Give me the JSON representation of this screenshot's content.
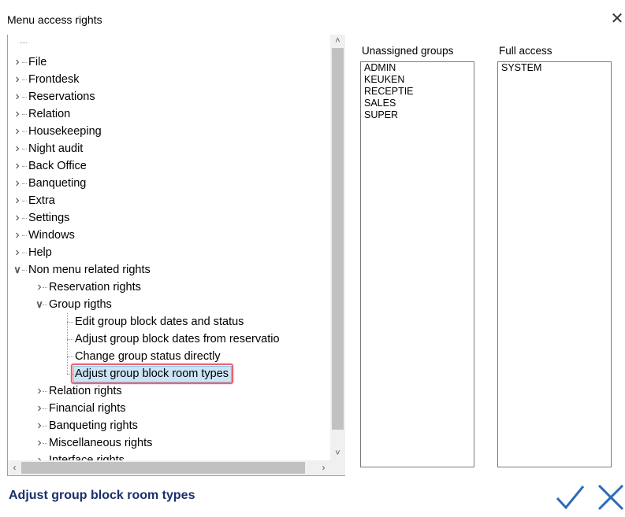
{
  "window": {
    "title": "Menu access rights",
    "close_icon": "close-icon"
  },
  "tree": {
    "items": [
      {
        "label": "",
        "level": 0,
        "state": "root-dots"
      },
      {
        "label": "File",
        "level": 0,
        "state": "collapsed"
      },
      {
        "label": "Frontdesk",
        "level": 0,
        "state": "collapsed"
      },
      {
        "label": "Reservations",
        "level": 0,
        "state": "collapsed"
      },
      {
        "label": "Relation",
        "level": 0,
        "state": "collapsed"
      },
      {
        "label": "Housekeeping",
        "level": 0,
        "state": "collapsed"
      },
      {
        "label": "Night audit",
        "level": 0,
        "state": "collapsed"
      },
      {
        "label": "Back Office",
        "level": 0,
        "state": "collapsed"
      },
      {
        "label": "Banqueting",
        "level": 0,
        "state": "collapsed"
      },
      {
        "label": "Extra",
        "level": 0,
        "state": "collapsed"
      },
      {
        "label": "Settings",
        "level": 0,
        "state": "collapsed"
      },
      {
        "label": "Windows",
        "level": 0,
        "state": "collapsed"
      },
      {
        "label": "Help",
        "level": 0,
        "state": "collapsed"
      },
      {
        "label": "Non menu related rights",
        "level": 0,
        "state": "expanded"
      },
      {
        "label": "Reservation rights",
        "level": 1,
        "state": "collapsed"
      },
      {
        "label": "Group rigths",
        "level": 1,
        "state": "expanded"
      },
      {
        "label": "Edit group block dates and status",
        "level": 2,
        "state": "leaf"
      },
      {
        "label": "Adjust group block dates from reservatio",
        "level": 2,
        "state": "leaf"
      },
      {
        "label": "Change group status directly",
        "level": 2,
        "state": "leaf"
      },
      {
        "label": "Adjust group block room types",
        "level": 2,
        "state": "leaf",
        "selected": true
      },
      {
        "label": "Relation rights",
        "level": 1,
        "state": "collapsed"
      },
      {
        "label": "Financial rights",
        "level": 1,
        "state": "collapsed"
      },
      {
        "label": "Banqueting rights",
        "level": 1,
        "state": "collapsed"
      },
      {
        "label": "Miscellaneous rights",
        "level": 1,
        "state": "collapsed"
      },
      {
        "label": "Interface rights",
        "level": 1,
        "state": "collapsed"
      }
    ]
  },
  "scrollbars": {
    "up_icon": "chevron-up-icon",
    "down_icon": "chevron-down-icon",
    "left_icon": "chevron-left-icon",
    "right_icon": "chevron-right-icon"
  },
  "groups": {
    "unassigned_header": "Unassigned groups",
    "unassigned": [
      "ADMIN",
      "KEUKEN",
      "RECEPTIE",
      "SALES",
      "SUPER"
    ],
    "full_access_header": "Full access",
    "full_access": [
      "SYSTEM"
    ]
  },
  "status": {
    "text": "Adjust group block room types"
  },
  "buttons": {
    "ok_icon": "check-icon",
    "cancel_icon": "close-icon"
  },
  "colors": {
    "accent": "#2b6cb8",
    "status_text": "#1a2f6b",
    "selection": "#cce4f7",
    "highlight_border": "#e06870"
  }
}
